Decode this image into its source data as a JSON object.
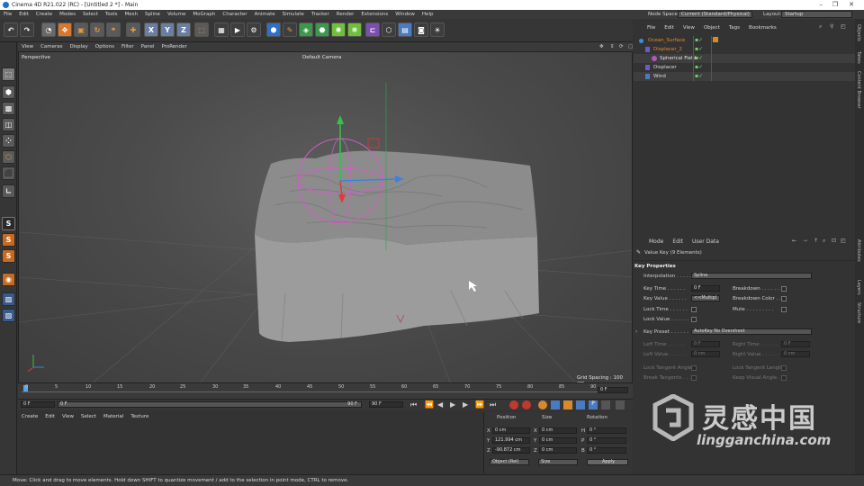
{
  "window": {
    "title": "Cinema 4D R21.022 (RC) - [Untitled 2 *] - Main"
  },
  "menu": [
    "File",
    "Edit",
    "Create",
    "Modes",
    "Select",
    "Tools",
    "Mesh",
    "Spline",
    "Volume",
    "MoGraph",
    "Character",
    "Animate",
    "Simulate",
    "Tracker",
    "Render",
    "Extensions",
    "Window",
    "Help"
  ],
  "node_space": {
    "label": "Node Space:",
    "value": "Current (Standard/Physical)"
  },
  "layout": {
    "label": "Layout:",
    "value": "Startup"
  },
  "viewport": {
    "menu": [
      "View",
      "Cameras",
      "Display",
      "Options",
      "Filter",
      "Panel",
      "ProRender"
    ],
    "name": "Perspective",
    "camera": "Default Camera",
    "grid_spacing": "Grid Spacing : 100 cm"
  },
  "timeline": {
    "ticks": [
      "0",
      "5",
      "10",
      "15",
      "20",
      "25",
      "30",
      "35",
      "40",
      "45",
      "50",
      "55",
      "60",
      "65",
      "70",
      "75",
      "80",
      "85",
      "90"
    ],
    "end_label": "0 F",
    "current_frame": "0 F",
    "start_frame": "0 F",
    "end_frame": "90 F",
    "max_frame": "90 F"
  },
  "material_menu": [
    "Create",
    "Edit",
    "View",
    "Select",
    "Material",
    "Texture"
  ],
  "coordinates": {
    "headers": [
      "Position",
      "Size",
      "Rotation"
    ],
    "rows": [
      {
        "axis": "X",
        "pos": "0 cm",
        "size_axis": "X",
        "size": "0 cm",
        "rot_axis": "H",
        "rot": "0 °"
      },
      {
        "axis": "Y",
        "pos": "121.994 cm",
        "size_axis": "Y",
        "size": "0 cm",
        "rot_axis": "P",
        "rot": "0 °"
      },
      {
        "axis": "Z",
        "pos": "-90.872 cm",
        "size_axis": "Z",
        "size": "0 cm",
        "rot_axis": "B",
        "rot": "0 °"
      }
    ],
    "mode": "Object (Rel)",
    "size_mode": "Size",
    "apply": "Apply"
  },
  "status": "Move: Click and drag to move elements. Hold down SHIFT to quantize movement / add to the selection in point mode, CTRL to remove.",
  "object_manager": {
    "menu": [
      "File",
      "Edit",
      "View",
      "Object",
      "Tags",
      "Bookmarks"
    ],
    "objects": [
      {
        "name": "Ocean_Surface",
        "color": "#e08a2a",
        "indent": 0
      },
      {
        "name": "Displacer_2",
        "color": "#e08a2a",
        "indent": 1
      },
      {
        "name": "Spherical Field",
        "color": "#e6e6e6",
        "indent": 2
      },
      {
        "name": "Displacer",
        "color": "#dddddd",
        "indent": 1
      },
      {
        "name": "Wind",
        "color": "#dddddd",
        "indent": 1
      }
    ]
  },
  "attributes": {
    "menu": [
      "Mode",
      "Edit",
      "User Data"
    ],
    "selection": "Value Key (9 Elements)",
    "section": "Key Properties",
    "interpolation_label": "Interpolation . . . . .",
    "interpolation_value": "Spline",
    "key_time_label": "Key Time . . . . . .",
    "key_time_value": "0 F",
    "key_value_label": "Key Value . . . . . .",
    "key_value_value": "<<Multipl",
    "lock_time_label": "Lock Time . . . . . .",
    "lock_value_label": "Lock Value . . . . . .",
    "breakdown_label": "Breakdown . . . . . .",
    "breakdown_color_label": "Breakdown Color . .",
    "mute_label": "Mute . . . . . . . . .",
    "key_preset_label": "Key Preset . . . . . .",
    "key_preset_value": "AutoKey No Overshoot",
    "left_time_label": "Left Time . . . . . .",
    "left_time_value": "0 F",
    "right_time_label": "Right Time . . . . . .",
    "right_time_value": "0 F",
    "left_value_label": "Left Value . . . . . .",
    "left_value_value": "0 cm",
    "right_value_label": "Right Value . . . . .",
    "right_value_value": "0 cm",
    "lock_tangent_angles_label": "Lock Tangent Angles",
    "lock_tangent_lengths_label": "Lock Tangent Lengths",
    "break_tangents_label": "Break Tangents . . .",
    "keep_visual_angle_label": "Keep Visual Angle . ."
  },
  "side_tabs": [
    "Objects",
    "Takes",
    "Content Browser",
    "Attributes",
    "Layers",
    "Structure"
  ],
  "watermark": {
    "cn": "灵感中国",
    "url": "lingganchina.com"
  }
}
